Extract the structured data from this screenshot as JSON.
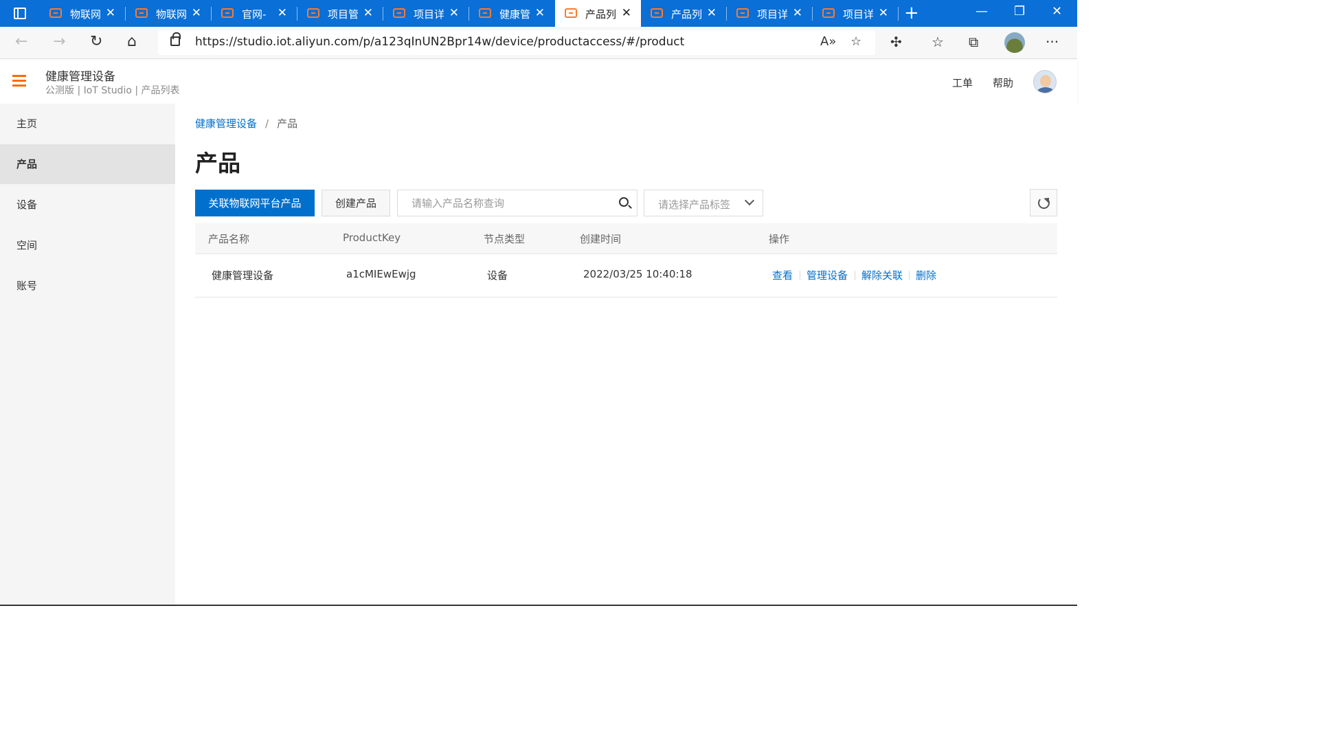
{
  "browser": {
    "tabs": [
      {
        "label": "物联网"
      },
      {
        "label": "物联网"
      },
      {
        "label": "官网-"
      },
      {
        "label": "项目管"
      },
      {
        "label": "项目详"
      },
      {
        "label": "健康管"
      },
      {
        "label": "产品列"
      },
      {
        "label": "产品列"
      },
      {
        "label": "项目详"
      },
      {
        "label": "项目详"
      }
    ],
    "url": "https://studio.iot.aliyun.com/p/a123qInUN2Bpr14w/device/productaccess/#/product"
  },
  "header": {
    "title": "健康管理设备",
    "subtitle": "公测版 | IoT Studio | 产品列表",
    "links": {
      "ticket": "工单",
      "help": "帮助"
    }
  },
  "sidebar": {
    "items": [
      {
        "label": "主页"
      },
      {
        "label": "产品"
      },
      {
        "label": "设备"
      },
      {
        "label": "空间"
      },
      {
        "label": "账号"
      }
    ]
  },
  "main": {
    "breadcrumb": {
      "parent": "健康管理设备",
      "separator": "/",
      "current": "产品"
    },
    "title": "产品",
    "toolbar": {
      "link_button": "关联物联网平台产品",
      "create_button": "创建产品",
      "search_placeholder": "请输入产品名称查询",
      "tag_select_placeholder": "请选择产品标签"
    },
    "table": {
      "columns": [
        "产品名称",
        "ProductKey",
        "节点类型",
        "创建时间",
        "操作"
      ],
      "rows": [
        {
          "name": "健康管理设备",
          "product_key": "a1cMIEwEwjg",
          "node_type": "设备",
          "created": "2022/03/25 10:40:18",
          "actions": [
            "查看",
            "管理设备",
            "解除关联",
            "删除"
          ]
        }
      ]
    }
  },
  "colors": {
    "primary": "#0070cc",
    "accent": "#ff6a00",
    "browser_bar": "#0a6fd6"
  }
}
